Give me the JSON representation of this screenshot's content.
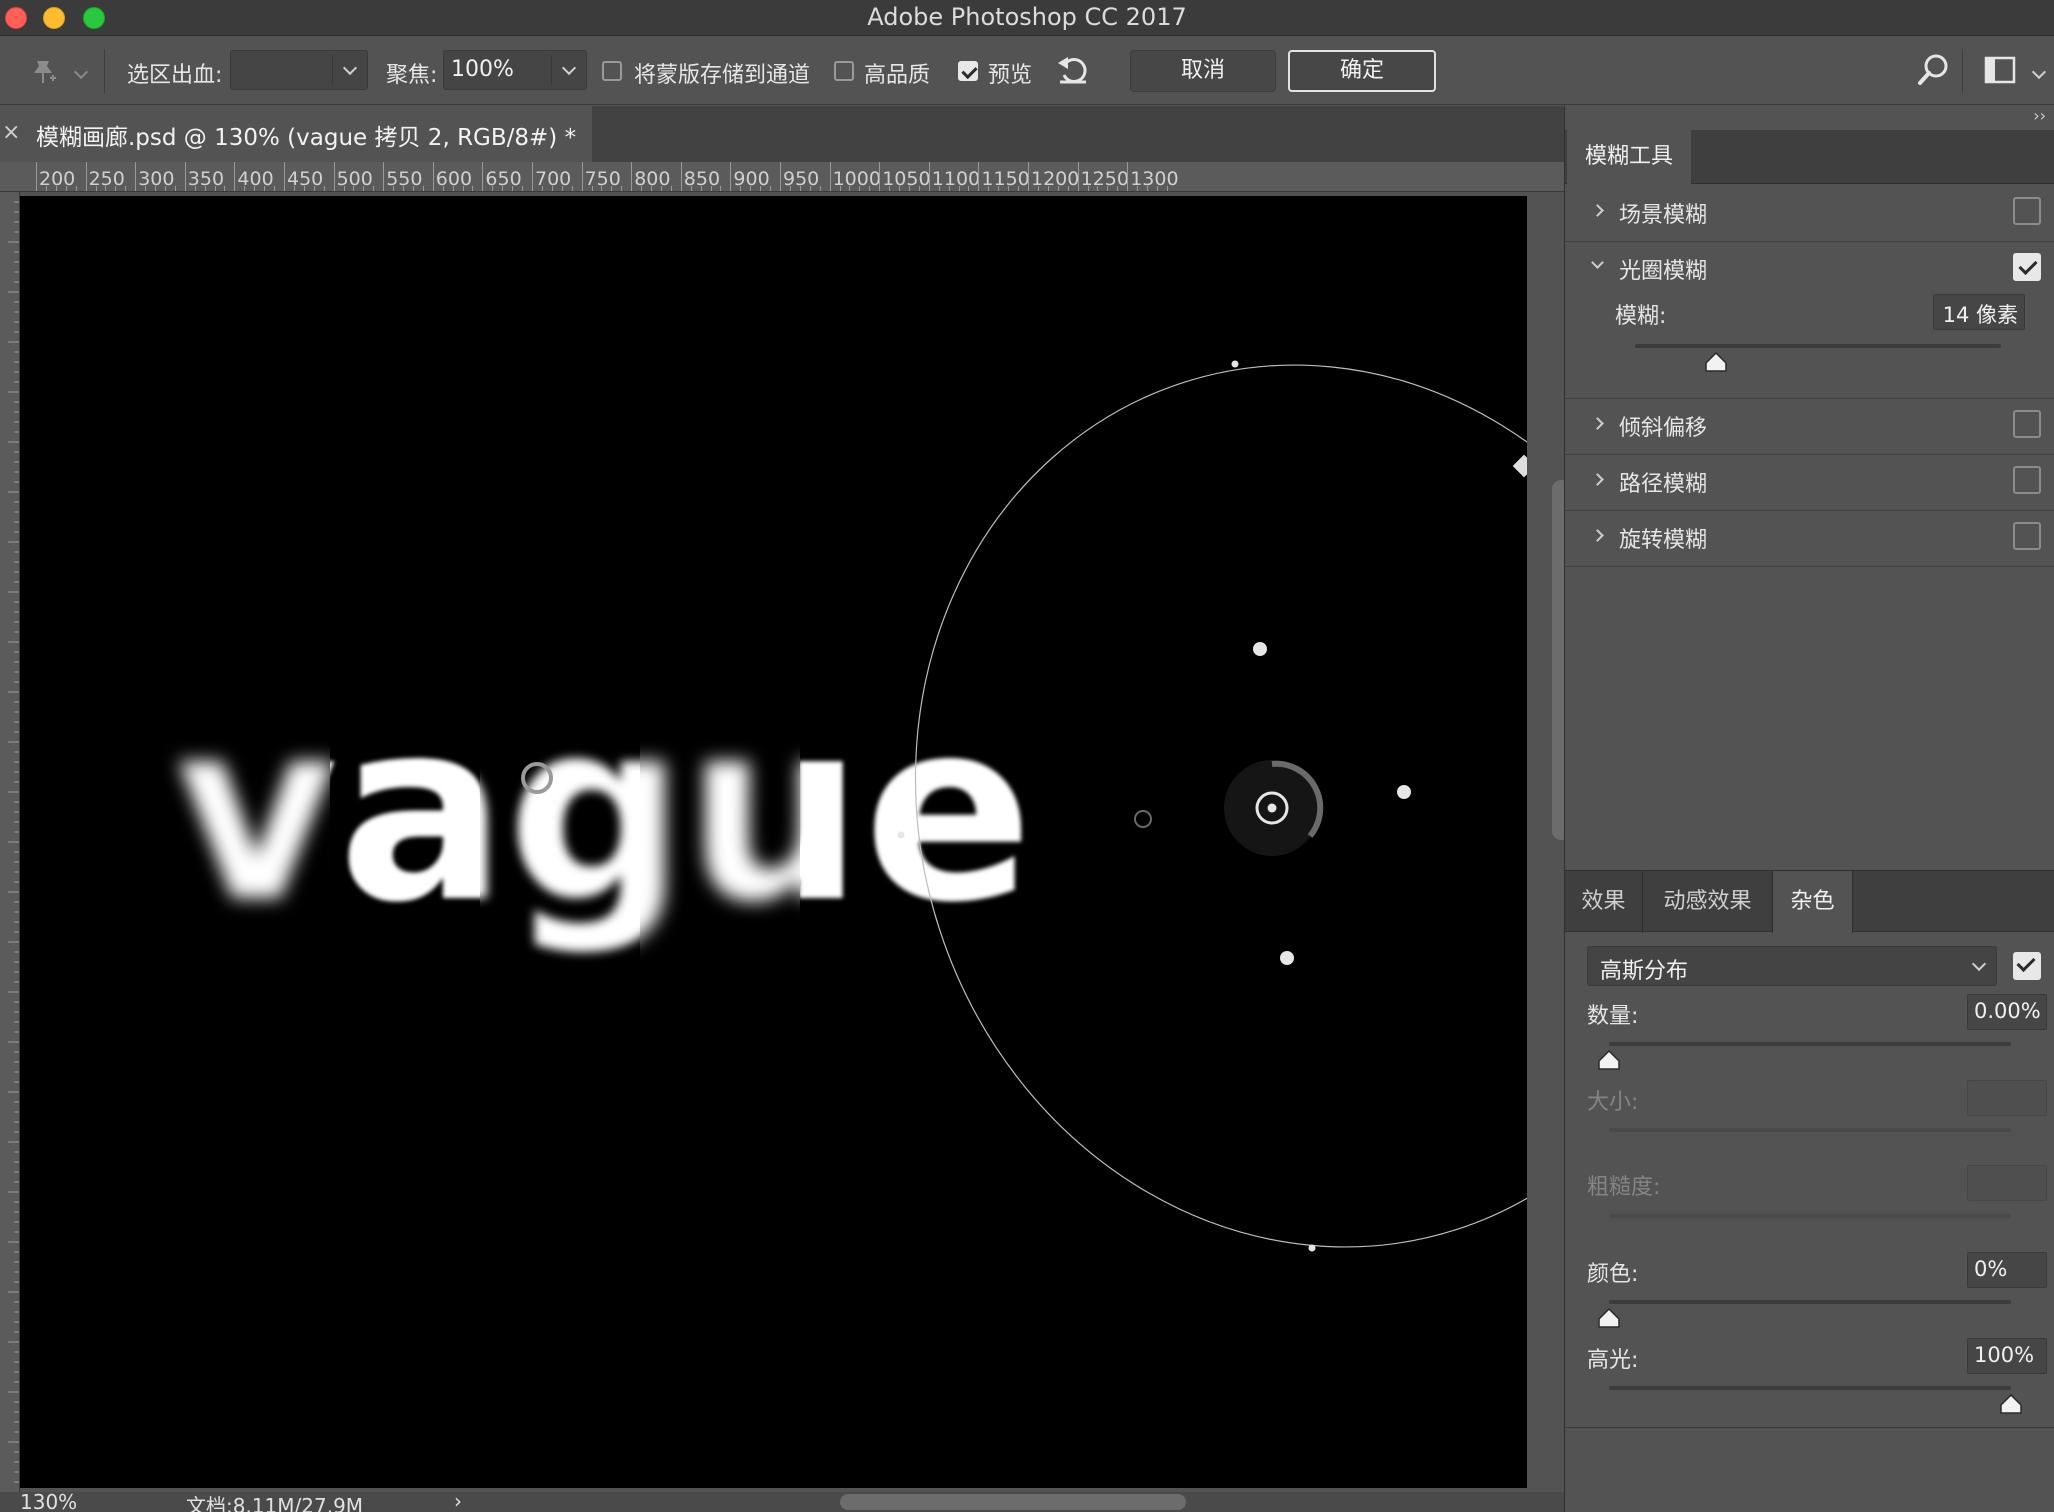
{
  "window": {
    "title": "Adobe Photoshop CC 2017"
  },
  "options_bar": {
    "selection_bleed_label": "选区出血:",
    "selection_bleed_value": "",
    "focus_label": "聚焦:",
    "focus_value": "100%",
    "save_mask_label": "将蒙版存储到通道",
    "save_mask_checked": false,
    "high_quality_label": "高品质",
    "high_quality_checked": false,
    "preview_label": "预览",
    "preview_checked": true,
    "cancel_label": "取消",
    "ok_label": "确定",
    "icons": [
      "pin-icon",
      "reset-icon",
      "search-icon",
      "workspace-icon"
    ]
  },
  "document_tab": {
    "close": "×",
    "name": "模糊画廊.psd @ 130% (vague 拷贝 2, RGB/8#) *"
  },
  "ruler": {
    "labels": [
      "200",
      "250",
      "300",
      "350",
      "400",
      "450",
      "500",
      "550",
      "600",
      "650",
      "700",
      "750",
      "800",
      "850",
      "900",
      "950",
      "1000",
      "1050",
      "1100",
      "1150",
      "1200",
      "1250",
      "1300"
    ]
  },
  "canvas": {
    "text": "vague",
    "background_color": "#000000",
    "text_color": "#ffffff"
  },
  "status_bar": {
    "zoom": "130%",
    "doc_size": "文档:8.11M/27.9M",
    "arrow": "›"
  },
  "panel": {
    "collapse": "››",
    "title": "模糊工具",
    "blur_tools": [
      {
        "label": "场景模糊",
        "expanded": false,
        "checked": false
      },
      {
        "label": "光圈模糊",
        "expanded": true,
        "checked": true
      },
      {
        "label": "倾斜偏移",
        "expanded": false,
        "checked": false
      },
      {
        "label": "路径模糊",
        "expanded": false,
        "checked": false
      },
      {
        "label": "旋转模糊",
        "expanded": false,
        "checked": false
      }
    ],
    "iris": {
      "blur_label": "模糊:",
      "blur_value": "14 像素",
      "blur_level": 0.22
    },
    "effects_tabs": [
      {
        "label": "效果",
        "active": false
      },
      {
        "label": "动感效果",
        "active": false
      },
      {
        "label": "杂色",
        "active": true
      }
    ],
    "noise": {
      "distribution": "高斯分布",
      "enabled": true,
      "amount_label": "数量:",
      "amount_value": "0.00%",
      "amount_level": 0,
      "size_label": "大小:",
      "size_value": "",
      "roughness_label": "粗糙度:",
      "roughness_value": "",
      "color_label": "颜色:",
      "color_value": "0%",
      "color_level": 0,
      "highlight_label": "高光:",
      "highlight_value": "100%",
      "highlight_level": 1
    }
  }
}
